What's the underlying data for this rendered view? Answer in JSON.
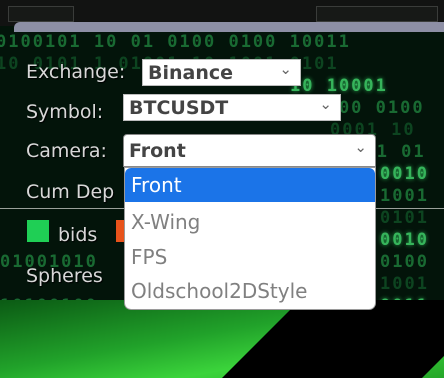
{
  "controls": {
    "exchange": {
      "label": "Exchange:",
      "value": "Binance"
    },
    "symbol": {
      "label": "Symbol:",
      "value": "BTCUSDT"
    },
    "camera": {
      "label": "Camera:",
      "value": "Front",
      "options": [
        "Front",
        "X-Wing",
        "FPS",
        "Oldschool2DStyle"
      ],
      "highlighted": "Front"
    },
    "cum_depth": {
      "label": "Cum Dep"
    },
    "legend": {
      "bids_label": "bids",
      "bids_color": "#1fcf55",
      "asks_color": "#e8531b"
    },
    "spheres": {
      "label": "Spheres"
    }
  },
  "chevron_glyph": "⌄"
}
